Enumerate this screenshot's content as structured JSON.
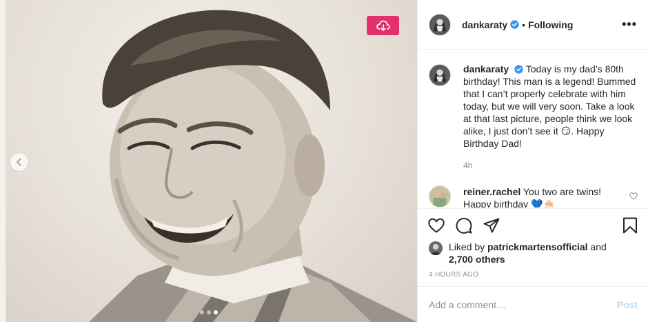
{
  "photo": {
    "alt_subject": "",
    "carousel": {
      "dots": 3,
      "active_index": 2
    }
  },
  "download_icon": "cloud-download-icon",
  "prev_icon": "chevron-left-icon",
  "header": {
    "username": "dankaraty",
    "separator": "•",
    "following": "Following",
    "more": "•••"
  },
  "caption": {
    "username": "dankaraty",
    "text_main": "Today is my dad’s 80th birthday! This man is a legend! Bummed that I can’t properly celebrate with him today, but we will very soon. Take a look at that last picture, people think we look alike, I just don’t see it",
    "emoji": "😏",
    "text_end": ". Happy Birthday Dad!",
    "time": "4h"
  },
  "comment": {
    "username": "reiner.rachel",
    "text": "You two are twins!",
    "text2": "Happy birthday 💙🎂"
  },
  "actions": {
    "like_icon": "heart-icon",
    "comment_icon": "comment-icon",
    "share_icon": "share-icon",
    "save_icon": "bookmark-icon"
  },
  "likes": {
    "prefix": "Liked by ",
    "user": "patrickmartensofficial",
    "and": " and",
    "others": "2,700 others"
  },
  "timestamp": "4 HOURS AGO",
  "add_comment": {
    "placeholder": "Add a comment…",
    "post": "Post"
  },
  "colors": {
    "download_bg": "#e1306c",
    "verified": "#3897f0",
    "post_disabled": "#b2dffc",
    "muted": "#8e8e8e"
  }
}
